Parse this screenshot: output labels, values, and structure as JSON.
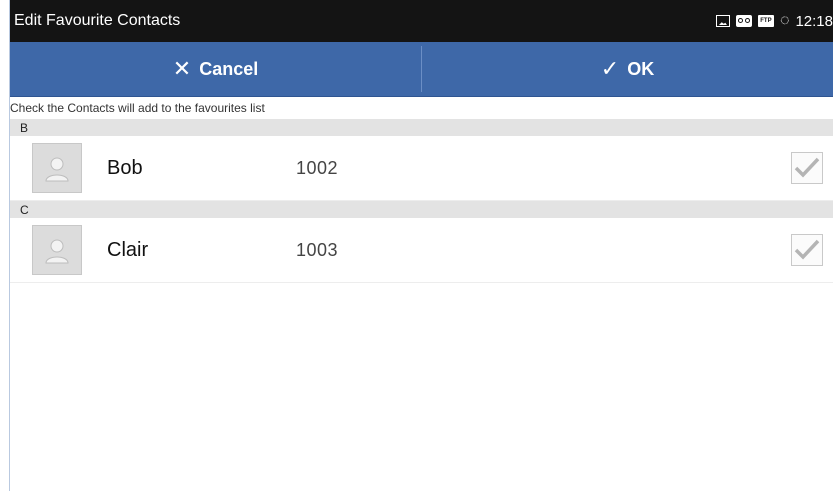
{
  "statusbar": {
    "title": "Edit Favourite Contacts",
    "time": "12:18",
    "icons": [
      "image-icon",
      "voicemail-icon",
      "ftp-icon",
      "sync-icon"
    ]
  },
  "actions": {
    "cancel_label": "Cancel",
    "ok_label": "OK",
    "bar_color": "#3e68a8"
  },
  "hint": "Check the Contacts will add to the favourites list",
  "sections": [
    {
      "header": "B",
      "contact": {
        "name": "Bob",
        "number": "1002",
        "checked": true
      }
    },
    {
      "header": "C",
      "contact": {
        "name": "Clair",
        "number": "1003",
        "checked": true
      }
    }
  ]
}
